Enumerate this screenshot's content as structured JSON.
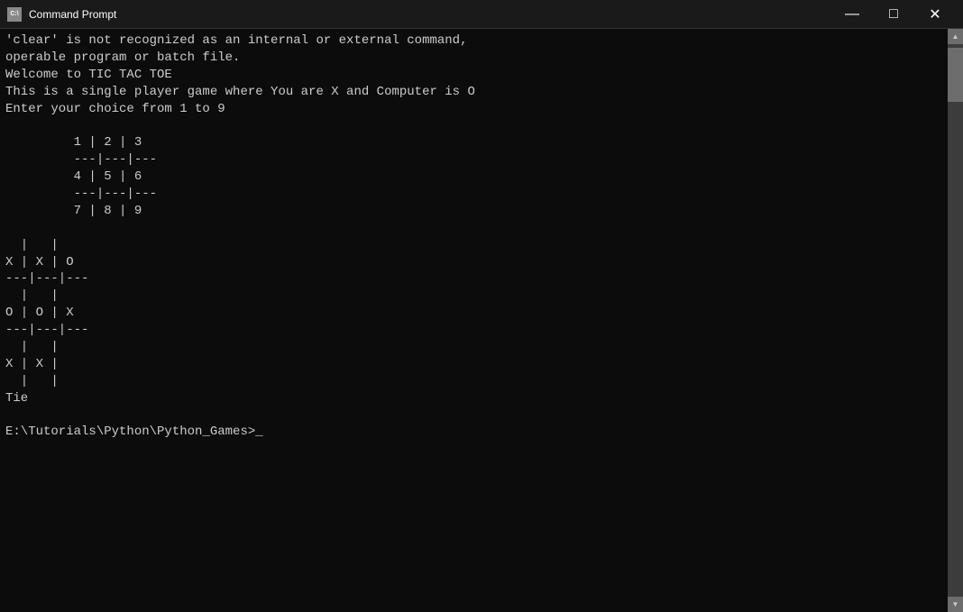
{
  "window": {
    "title": "Command Prompt",
    "icon_label": "C:\\",
    "minimize_label": "—",
    "maximize_label": "□",
    "close_label": "✕"
  },
  "console": {
    "content": "'clear' is not recognized as an internal or external command,\noperable program or batch file.\nWelcome to TIC TAC TOE\nThis is a single player game where You are X and Computer is O\nEnter your choice from 1 to 9\n\n         1 | 2 | 3\n         ---|---|---\n         4 | 5 | 6\n         ---|---|---\n         7 | 8 | 9\n\n  |   |\n  X | X | O\n  ---|---|---\n  |   |\n  O | O | X\n  ---|---|---\n  |   |\n  X | X |\n  |   |\nTie\n\nE:\\Tutorials\\Python\\Python_Games>_"
  },
  "scrollbar": {
    "up_arrow": "▲",
    "down_arrow": "▼"
  }
}
